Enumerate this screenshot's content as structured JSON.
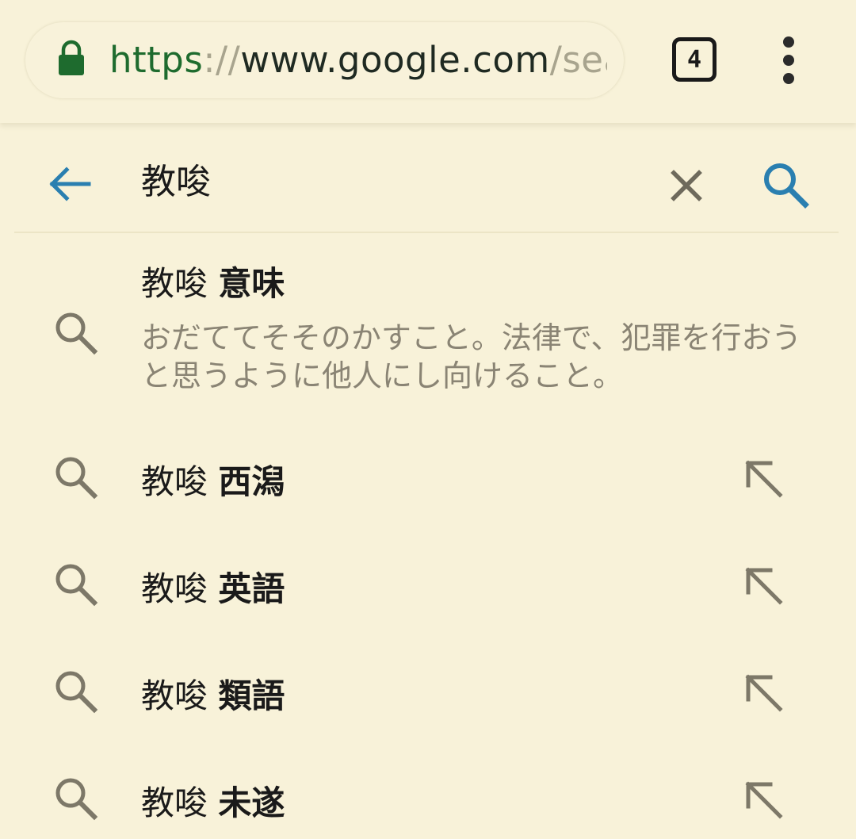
{
  "browser": {
    "url": {
      "scheme": "https",
      "separator": "://",
      "host": "www.google.com",
      "path": "/sea"
    },
    "tab_count": "4",
    "icons": {
      "lock": "lock-icon",
      "menu": "overflow-menu-icon"
    },
    "colors": {
      "secure": "#1e6b2e",
      "accent": "#2a7fb0"
    }
  },
  "search": {
    "query": "教唆",
    "icons": {
      "back": "arrow-left-icon",
      "clear": "close-icon",
      "submit": "search-icon"
    }
  },
  "suggestions": [
    {
      "prefix": "教唆",
      "suffix": "意味",
      "description": "おだててそそのかすこと。法律で、犯罪を行おうと思うように他人にし向けること。",
      "icon": "search-icon"
    },
    {
      "prefix": "教唆",
      "suffix": "西潟",
      "icon": "search-icon",
      "action_icon": "arrow-up-left-icon"
    },
    {
      "prefix": "教唆",
      "suffix": "英語",
      "icon": "search-icon",
      "action_icon": "arrow-up-left-icon"
    },
    {
      "prefix": "教唆",
      "suffix": "類語",
      "icon": "search-icon",
      "action_icon": "arrow-up-left-icon"
    },
    {
      "prefix": "教唆",
      "suffix": "未遂",
      "icon": "search-icon",
      "action_icon": "arrow-up-left-icon"
    }
  ]
}
